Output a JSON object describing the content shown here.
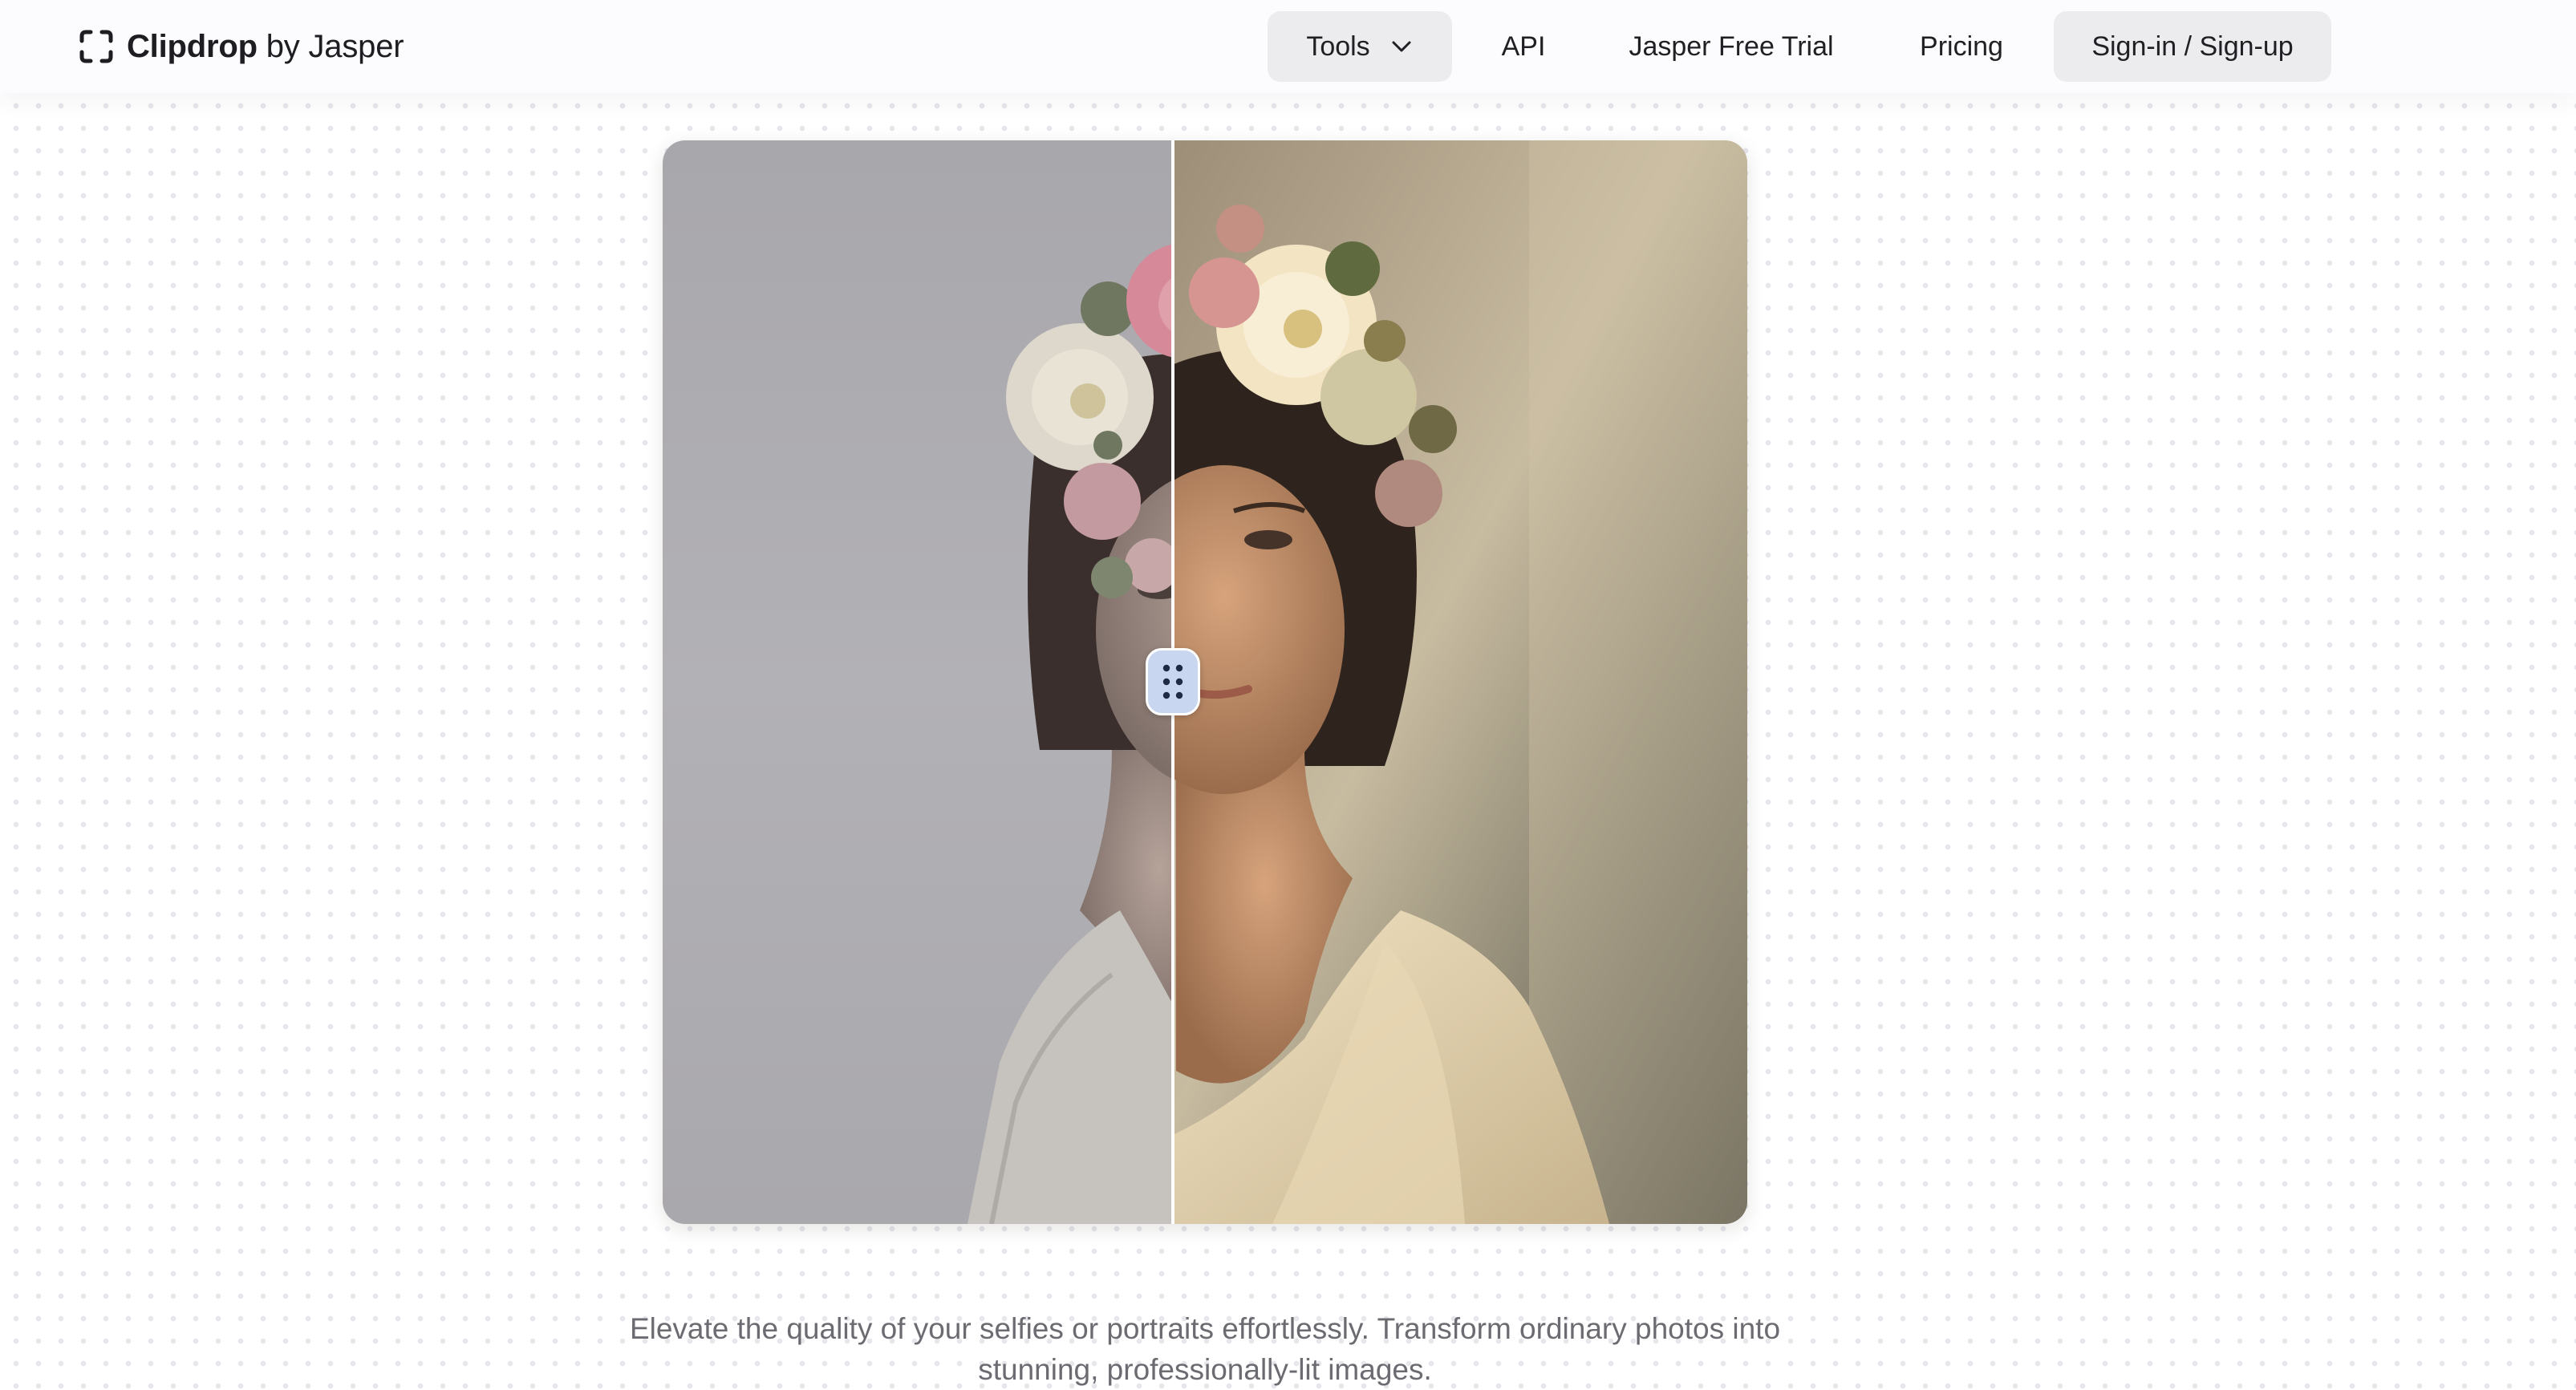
{
  "header": {
    "brand_bold": "Clipdrop",
    "brand_rest": " by Jasper",
    "nav": {
      "tools_label": "Tools",
      "api_label": "API",
      "trial_label": "Jasper Free Trial",
      "pricing_label": "Pricing",
      "signin_label": "Sign-in / Sign-up"
    }
  },
  "compare": {
    "before_image": "portrait-flat-lighting",
    "after_image": "portrait-relit-warm",
    "slider_position": 0.47,
    "handle_icon": "drag-grip-icon"
  },
  "description": {
    "line1": "Elevate the quality of your selfies or portraits effortlessly. Transform ordinary photos into",
    "line2": "stunning, professionally-lit images."
  },
  "colors": {
    "header_bg": "#fcfbfd",
    "nav_pill_bg": "#ececef",
    "handle_bg": "#c9d6ef",
    "text_primary": "#1d1d22",
    "text_secondary": "#6b6b72"
  }
}
